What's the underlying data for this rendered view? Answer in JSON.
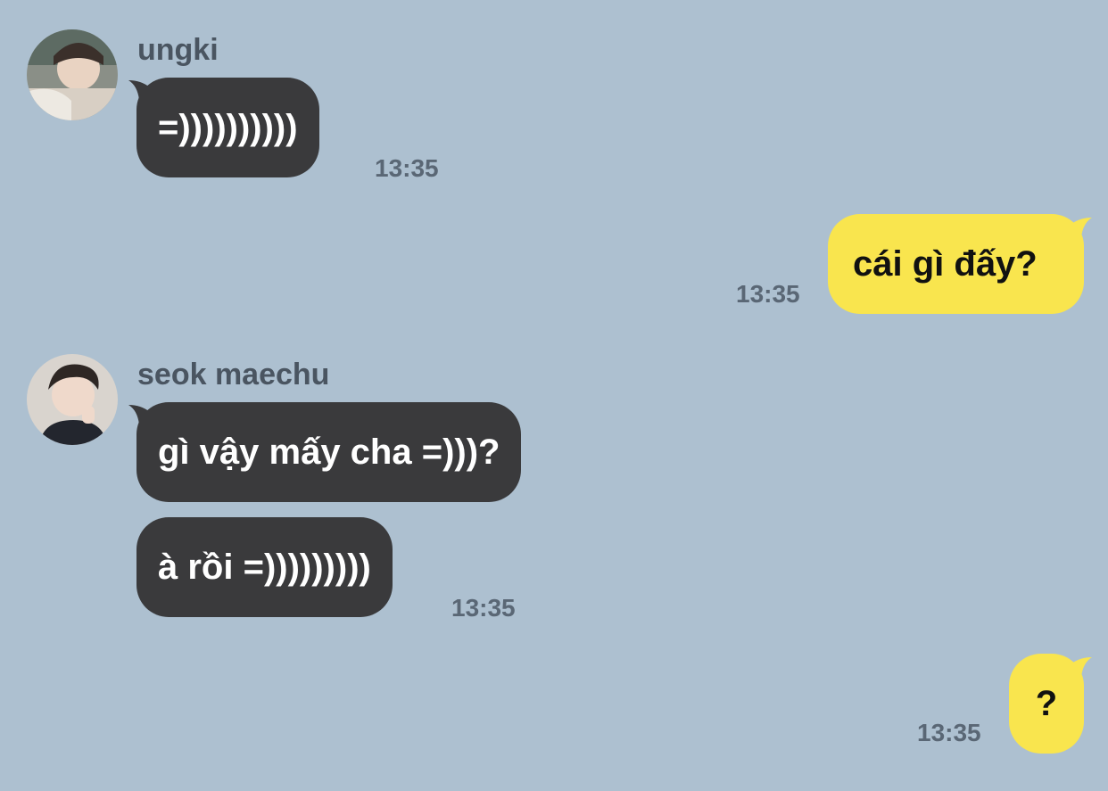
{
  "colors": {
    "background": "#adc0d0",
    "incoming_bubble": "#3a3a3c",
    "outgoing_bubble": "#f9e54e"
  },
  "messages": [
    {
      "sender": "ungki",
      "text": "=))))))))))",
      "time": "13:35"
    },
    {
      "text": "cái gì đấy?",
      "time": "13:35"
    },
    {
      "sender": "seok maechu",
      "text": "gì vậy mấy cha =)))?"
    },
    {
      "text": "à rồi =)))))))))",
      "time": "13:35"
    },
    {
      "text": "?",
      "time": "13:35"
    }
  ]
}
